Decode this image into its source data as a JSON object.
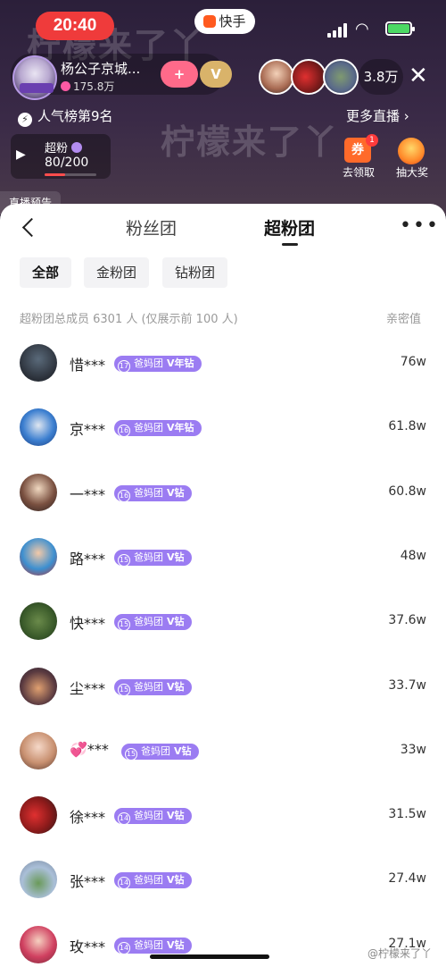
{
  "status": {
    "time": "20:40",
    "app_name": "快手"
  },
  "live": {
    "watermark": "柠檬来了丫",
    "anchor_name": "杨公子京城...",
    "anchor_likes": "175.8万",
    "viewer_count": "3.8万",
    "rank_text": "人气榜第9名",
    "more_live": "更多直播 ›",
    "fan_label": "超粉",
    "fan_progress": "80/200",
    "fan_progress_fraction": 0.4,
    "coupon_label": "去领取",
    "coupon_char": "券",
    "coupon_badge": "1",
    "lottery_label": "抽大奖",
    "peek_text": "直播预告"
  },
  "sheet": {
    "tabs": [
      {
        "label": "粉丝团"
      },
      {
        "label": "超粉团"
      }
    ],
    "filters": [
      {
        "label": "全部"
      },
      {
        "label": "金粉团"
      },
      {
        "label": "钻粉团"
      }
    ],
    "summary": "超粉团总成员 6301 人 (仅展示前 100 人)",
    "intimacy_header": "亲密值",
    "members": [
      {
        "name": "惜***",
        "level": "17",
        "group": "爸妈团",
        "badge": "V年钻",
        "intimacy": "76w"
      },
      {
        "name": "京***",
        "level": "16",
        "group": "爸妈团",
        "badge": "V年钻",
        "intimacy": "61.8w"
      },
      {
        "name": "一***",
        "level": "16",
        "group": "爸妈团",
        "badge": "V钻",
        "intimacy": "60.8w"
      },
      {
        "name": "路***",
        "level": "15",
        "group": "爸妈团",
        "badge": "V钻",
        "intimacy": "48w"
      },
      {
        "name": "快***",
        "level": "15",
        "group": "爸妈团",
        "badge": "V钻",
        "intimacy": "37.6w"
      },
      {
        "name": "尘***",
        "level": "15",
        "group": "爸妈团",
        "badge": "V钻",
        "intimacy": "33.7w"
      },
      {
        "name": "💞***",
        "level": "15",
        "group": "爸妈团",
        "badge": "V钻",
        "intimacy": "33w"
      },
      {
        "name": "徐***",
        "level": "14",
        "group": "爸妈团",
        "badge": "V钻",
        "intimacy": "31.5w"
      },
      {
        "name": "张***",
        "level": "14",
        "group": "爸妈团",
        "badge": "V钻",
        "intimacy": "27.4w"
      },
      {
        "name": "玫***",
        "level": "14",
        "group": "爸妈团",
        "badge": "V钻",
        "intimacy": "27.1w"
      }
    ]
  },
  "footer_watermark": "@柠檬来了丫"
}
